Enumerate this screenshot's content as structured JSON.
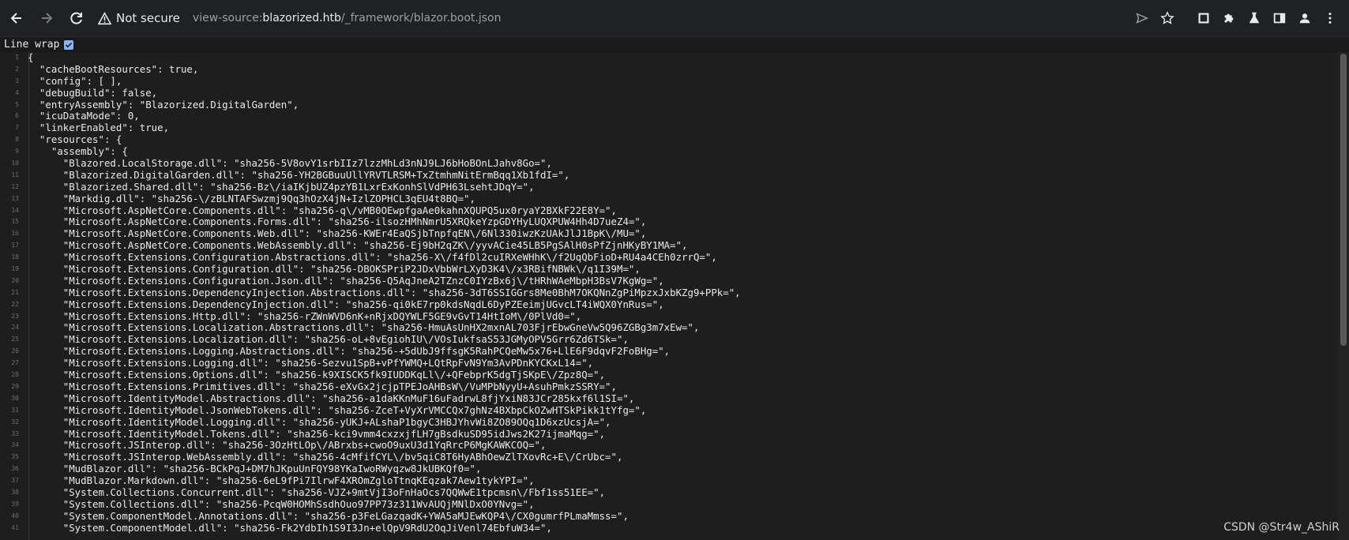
{
  "browser": {
    "security_label": "Not secure",
    "url_prefix": "view-source:",
    "url_host": "blazorized.htb",
    "url_path": "/_framework/blazor.boot.json"
  },
  "line_wrap_label": "Line wrap",
  "source_lines": [
    "{",
    "  \"cacheBootResources\": true,",
    "  \"config\": [ ],",
    "  \"debugBuild\": false,",
    "  \"entryAssembly\": \"Blazorized.DigitalGarden\",",
    "  \"icuDataMode\": 0,",
    "  \"linkerEnabled\": true,",
    "  \"resources\": {",
    "    \"assembly\": {",
    "      \"Blazored.LocalStorage.dll\": \"sha256-5V8ovY1srbIIz7lzzMhLd3nNJ9LJ6bHoBOnLJahv8Go=\",",
    "      \"Blazorized.DigitalGarden.dll\": \"sha256-YH2BGBuuUllYRVTLRSM+TxZtmhmNitErmBqq1Xb1fdI=\",",
    "      \"Blazorized.Shared.dll\": \"sha256-Bz\\/iaIKjbUZ4pzYB1LxrExKonhSlVdPH63LsehtJDqY=\",",
    "      \"Markdig.dll\": \"sha256-\\/zBLNTAFSwzmj9Qq3hOzX4jN+IzlZOPHCL3qEU4t8BQ=\",",
    "      \"Microsoft.AspNetCore.Components.dll\": \"sha256-q\\/vMB0OEwpfgaAe0kahnXQUPQ5ux0ryaY2BXkF22E8Y=\",",
    "      \"Microsoft.AspNetCore.Components.Forms.dll\": \"sha256-ilsozHMhNmrU5XRQkeYzpGDYHyLUQXPUW4Hh4D7ueZ4=\",",
    "      \"Microsoft.AspNetCore.Components.Web.dll\": \"sha256-KWEr4EaQSjbTnpfqEN\\/6Nl330iwzKzUAkJlJ1BpK\\/MU=\",",
    "      \"Microsoft.AspNetCore.Components.WebAssembly.dll\": \"sha256-Ej9bH2qZK\\/yyvACie45LB5PgSAlH0sPfZjnHKyBY1MA=\",",
    "      \"Microsoft.Extensions.Configuration.Abstractions.dll\": \"sha256-X\\/f4fDl2cuIRXeWHhK\\/f2UqQbFioD+RU4a4CEh0zrrQ=\",",
    "      \"Microsoft.Extensions.Configuration.dll\": \"sha256-DBOKSPriP2JDxVbbWrLXyD3K4\\/x3RBifNBWk\\/q1I39M=\",",
    "      \"Microsoft.Extensions.Configuration.Json.dll\": \"sha256-Q5AqJneA2TZnzC0IYzBx6j\\/tHRhWAeMbpH3BsV7KgWg=\",",
    "      \"Microsoft.Extensions.DependencyInjection.Abstractions.dll\": \"sha256-3dT6SSIGGrs8Me0BhM7OKQNnZgPiMpzxJxbKZg9+PPk=\",",
    "      \"Microsoft.Extensions.DependencyInjection.dll\": \"sha256-qi0kE7rp0kdsNqdL6DyPZEeimjUGvcLT4iWQX0YnRus=\",",
    "      \"Microsoft.Extensions.Http.dll\": \"sha256-rZWnWVD6nK+nRjxDQYWLF5GE9vGvT14HtIoM\\/0PlVd0=\",",
    "      \"Microsoft.Extensions.Localization.Abstractions.dll\": \"sha256-HmuAsUnHX2mxnAL703FjrEbwGneVw5Q96ZGBg3m7xEw=\",",
    "      \"Microsoft.Extensions.Localization.dll\": \"sha256-oL+8vEgiohIU\\/VOsIukfsaS53JGMyOPV5Grr6Zd6TSk=\",",
    "      \"Microsoft.Extensions.Logging.Abstractions.dll\": \"sha256-+5dUbJ9ffsgK5RahPCQeMw5x76+LlE6F9dqvF2FoBHg=\",",
    "      \"Microsoft.Extensions.Logging.dll\": \"sha256-Sezvu1SpB+vPfYWMQ+LQtRpFvN9Ym3AvPDnKYCKxL14=\",",
    "      \"Microsoft.Extensions.Options.dll\": \"sha256-k9XISCK5fk9IUDDKqLl\\/+QFebprK5dgTjSKpE\\/Zpz8Q=\",",
    "      \"Microsoft.Extensions.Primitives.dll\": \"sha256-eXvGx2jcjpTPEJoAHBsW\\/VuMPbNyyU+AsuhPmkzSSRY=\",",
    "      \"Microsoft.IdentityModel.Abstractions.dll\": \"sha256-a1daKKnMuF16uFadrwL8fjYxiN83JCr285kxf6l1SI=\",",
    "      \"Microsoft.IdentityModel.JsonWebTokens.dll\": \"sha256-ZceT+VyXrVMCCQx7ghNz4BXbpCkOZwHTSkPikk1tYfg=\",",
    "      \"Microsoft.IdentityModel.Logging.dll\": \"sha256-yUKJ+ALshaP1bgyC3HBJYhvWi8ZO89OQq1D6xzUcsjA=\",",
    "      \"Microsoft.IdentityModel.Tokens.dll\": \"sha256-kci9vmm4cxzxjfLH7gBsdkuSD95idJws2K27ijmaMqg=\",",
    "      \"Microsoft.JSInterop.dll\": \"sha256-3OzHtLOp\\/ABrxbs+cwoO9uxU3d1YqRrcP6MgKAWKCOQ=\",",
    "      \"Microsoft.JSInterop.WebAssembly.dll\": \"sha256-4cMfifCYL\\/bv5qiC8T6HyABhOewZlTXovRc+E\\/CrUbc=\",",
    "      \"MudBlazor.dll\": \"sha256-BCkPqJ+DM7hJKpuUnFQY98YKaIwoRWyqzw8JkUBKQf0=\",",
    "      \"MudBlazor.Markdown.dll\": \"sha256-6eL9fPi7IlrwF4XROmZgloTtnqKEqzak7Aew1tykYPI=\",",
    "      \"System.Collections.Concurrent.dll\": \"sha256-VJZ+9mtVjI3oFnHaOcs7QQWwE1tpcmsn\\/Fbf1ss51EE=\",",
    "      \"System.Collections.dll\": \"sha256-PcqW0HOMhSsdhOuo97PP73z311WvAUQjMNlDxO0YNvg=\",",
    "      \"System.ComponentModel.Annotations.dll\": \"sha256-p3FeLGazqadK+YWA5aMJEwKQP4\\/CX0gumrfPLmaMmss=\",",
    "      \"System.ComponentModel.dll\": \"sha256-Fk2YdbIh1S9I3Jn+elQpV9RdU2OqJiVenl74EbfuW34=\","
  ],
  "watermark": "CSDN @Str4w_AShiR"
}
